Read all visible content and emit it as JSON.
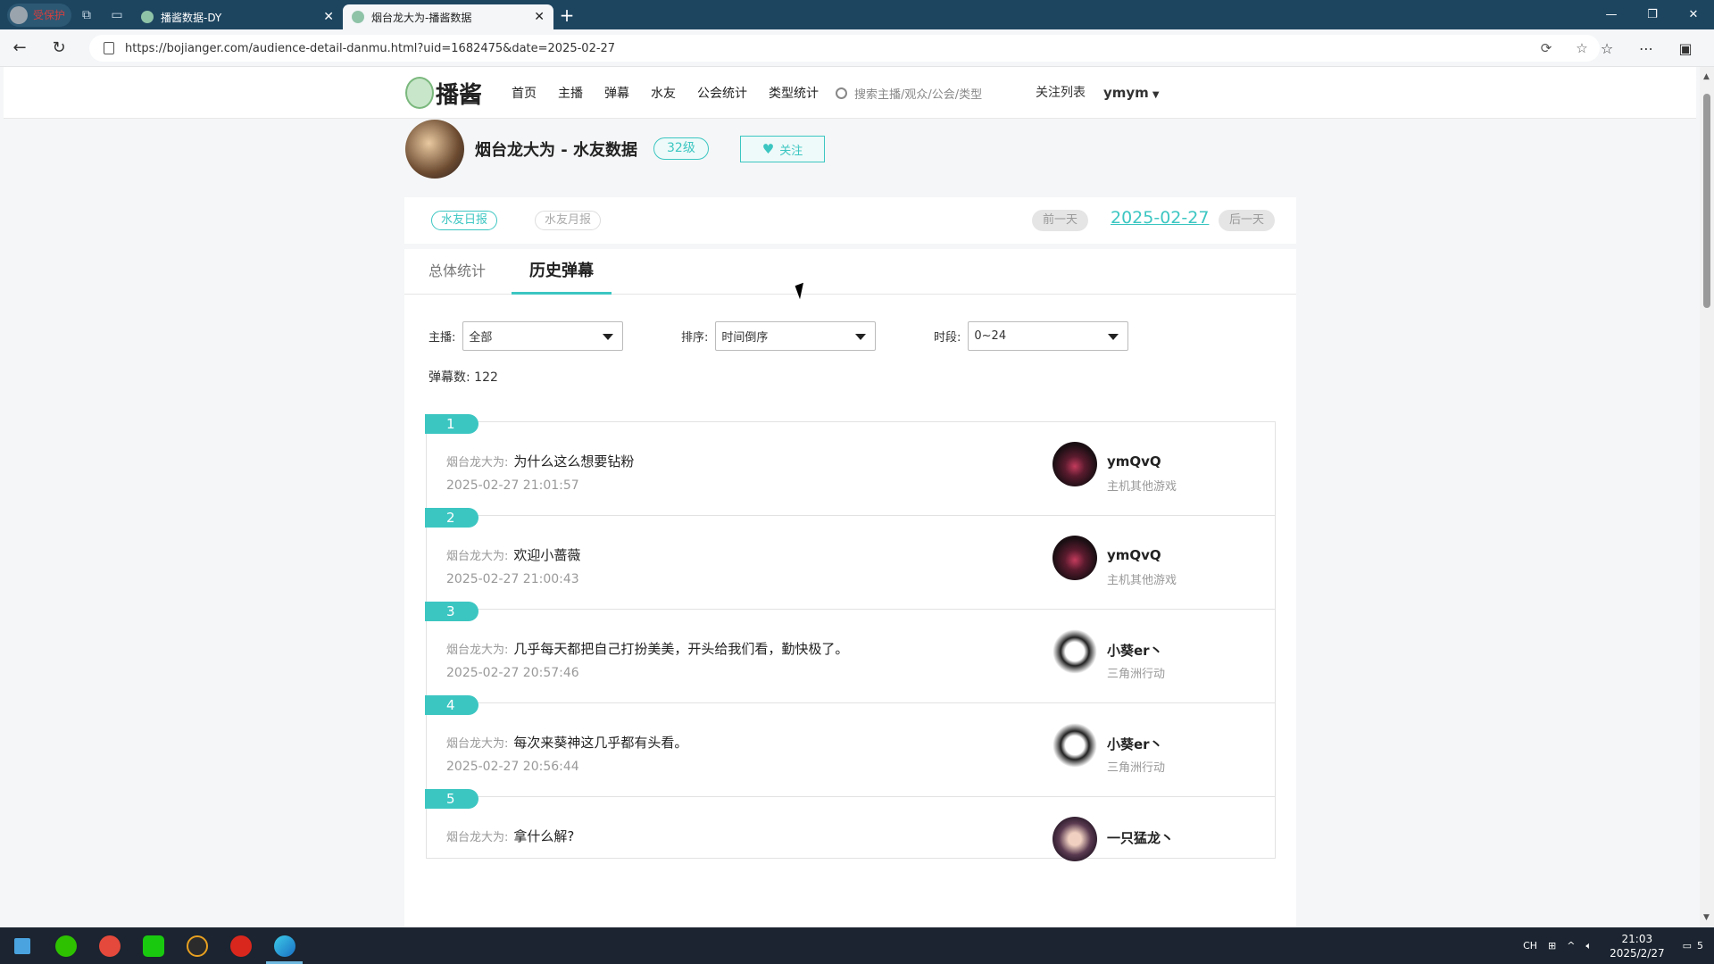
{
  "browser": {
    "profile_label": "受保护",
    "tabs": [
      {
        "title": "播酱数据-DY",
        "active": false
      },
      {
        "title": "烟台龙大为-播酱数据",
        "active": true
      }
    ],
    "url": "https://bojianger.com/audience-detail-danmu.html?uid=1682475&date=2025-02-27"
  },
  "site": {
    "logo_text": "播酱",
    "menu": [
      "首页",
      "主播",
      "弹幕",
      "水友",
      "公会统计",
      "类型统计"
    ],
    "search_placeholder": "搜索主播/观众/公会/类型",
    "follow_list": "关注列表",
    "username": "ymym"
  },
  "anchor": {
    "title": "烟台龙大为 - 水友数据",
    "level": "32级",
    "follow_label": "关注"
  },
  "report": {
    "daily": "水友日报",
    "monthly": "水友月报",
    "prev_day": "前一天",
    "date": "2025-02-27",
    "next_day": "后一天"
  },
  "tabs": {
    "overall": "总体统计",
    "history": "历史弹幕"
  },
  "filters": {
    "anchor_label": "主播:",
    "anchor_value": "全部",
    "sort_label": "排序:",
    "sort_value": "时间倒序",
    "period_label": "时段:",
    "period_value": "0~24"
  },
  "danmu_count_label": "弹幕数: ",
  "danmu_count": "122",
  "danmu": [
    {
      "num": "1",
      "room": "烟台龙大为:",
      "text": "为什么这么想要钻粉",
      "time": "2025-02-27 21:01:57",
      "user": "ymQvQ",
      "game": "主机其他游戏",
      "avatar": "dark"
    },
    {
      "num": "2",
      "room": "烟台龙大为:",
      "text": "欢迎小蔷薇",
      "time": "2025-02-27 21:00:43",
      "user": "ymQvQ",
      "game": "主机其他游戏",
      "avatar": "dark"
    },
    {
      "num": "3",
      "room": "烟台龙大为:",
      "text": "几乎每天都把自己打扮美美，开头给我们看，勤快极了。",
      "time": "2025-02-27 20:57:46",
      "user": "小葵er丶",
      "game": "三角洲行动",
      "avatar": "sketch"
    },
    {
      "num": "4",
      "room": "烟台龙大为:",
      "text": "每次来葵神这几乎都有头看。",
      "time": "2025-02-27 20:56:44",
      "user": "小葵er丶",
      "game": "三角洲行动",
      "avatar": "sketch"
    },
    {
      "num": "5",
      "room": "烟台龙大为:",
      "text": "拿什么解?",
      "time": "",
      "user": "一只猛龙丶",
      "game": "",
      "avatar": "anime"
    }
  ],
  "taskbar": {
    "tray_lang": "CH",
    "time": "21:03",
    "date": "2025/2/27",
    "notif": "5"
  },
  "colors": {
    "accent": "#3cc6c2",
    "tabbar": "#1d4560",
    "taskbar": "#1b2430"
  }
}
